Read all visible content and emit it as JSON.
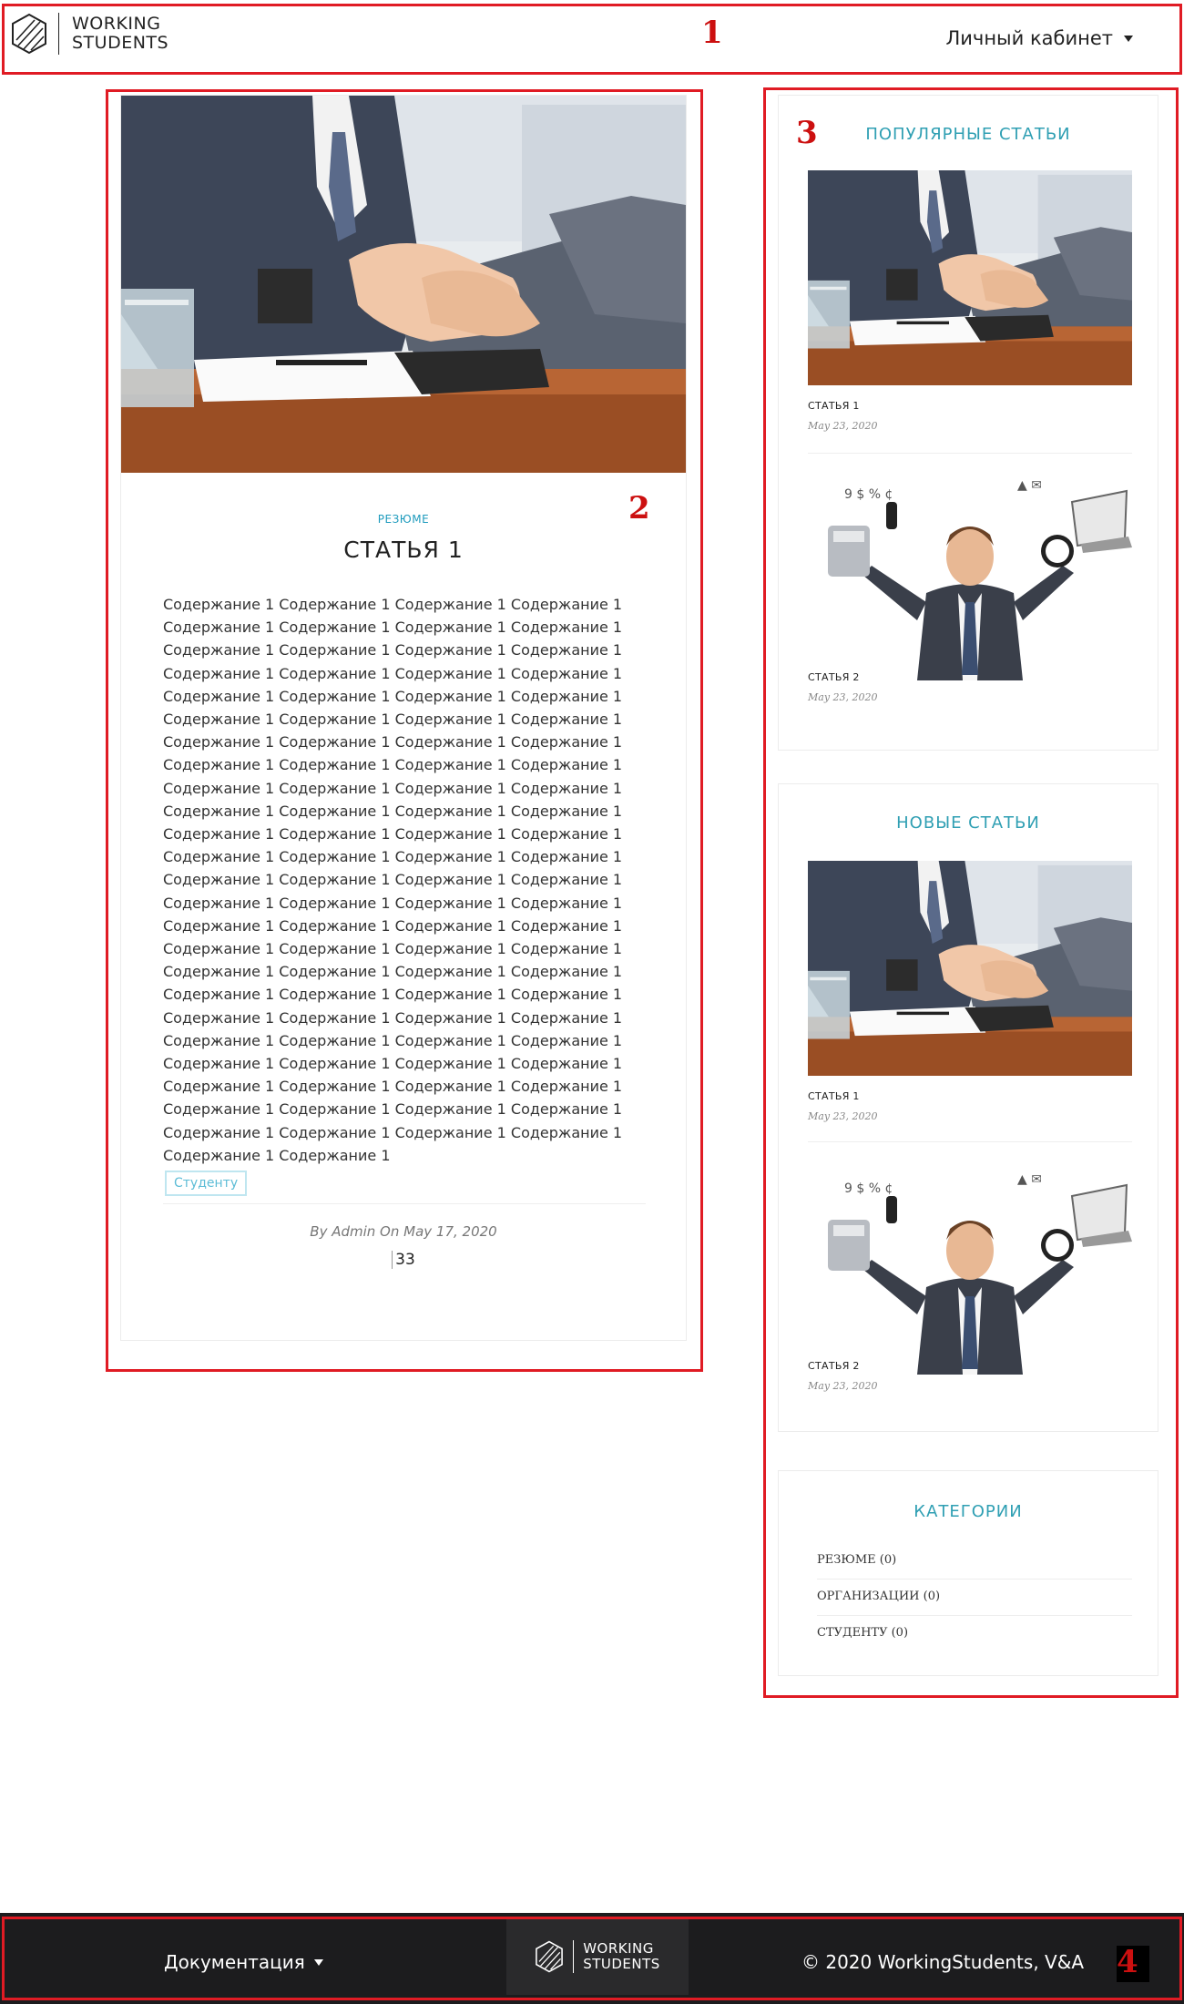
{
  "header": {
    "logo_line1": "WORKING",
    "logo_line2": "STUDENTS",
    "account_label": "Личный кабинет"
  },
  "annotations": [
    "1",
    "2",
    "3",
    "4"
  ],
  "article": {
    "category": "РЕЗЮМЕ",
    "title": "СТАТЬЯ 1",
    "body": "Содержание 1 Содержание 1 Содержание 1 Содержание 1 Содержание 1 Содержание 1 Содержание 1 Содержание 1 Содержание 1 Содержание 1 Содержание 1 Содержание 1 Содержание 1 Содержание 1 Содержание 1 Содержание 1 Содержание 1 Содержание 1 Содержание 1 Содержание 1 Содержание 1 Содержание 1 Содержание 1 Содержание 1 Содержание 1 Содержание 1 Содержание 1 Содержание 1 Содержание 1 Содержание 1 Содержание 1 Содержание 1 Содержание 1 Содержание 1 Содержание 1 Содержание 1 Содержание 1 Содержание 1 Содержание 1 Содержание 1 Содержание 1 Содержание 1 Содержание 1 Содержание 1 Содержание 1 Содержание 1 Содержание 1 Содержание 1 Содержание 1 Содержание 1 Содержание 1 Содержание 1 Содержание 1 Содержание 1 Содержание 1 Содержание 1 Содержание 1 Содержание 1 Содержание 1 Содержание 1 Содержание 1 Содержание 1 Содержание 1 Содержание 1 Содержание 1 Содержание 1 Содержание 1 Содержание 1 Содержание 1 Содержание 1 Содержание 1 Содержание 1 Содержание 1 Содержание 1 Содержание 1 Содержание 1 Содержание 1 Содержание 1 Содержание 1 Содержание 1 Содержание 1 Содержание 1 Содержание 1 Содержание 1 Содержание 1 Содержание 1 Содержание 1 Содержание 1 Содержание 1 Содержание 1 Содержание 1 Содержание 1 Содержание 1 Содержание 1 Содержание 1 Содержание 1 Содержание 1 Содержание 1",
    "tag": "Студенту",
    "byline": "By Admin On May 17, 2020",
    "views": "33"
  },
  "sidebar": {
    "popular": {
      "title": "ПОПУЛЯРНЫЕ СТАТЬИ",
      "posts": [
        {
          "title": "СТАТЬЯ 1",
          "date": "May 23, 2020",
          "image": "handshake-photo"
        },
        {
          "title": "СТАТЬЯ 2",
          "date": "May 23, 2020",
          "image": "multitasking-businessman-photo"
        }
      ]
    },
    "new": {
      "title": "НОВЫЕ СТАТЬИ",
      "posts": [
        {
          "title": "СТАТЬЯ 1",
          "date": "May 23, 2020",
          "image": "handshake-photo"
        },
        {
          "title": "СТАТЬЯ 2",
          "date": "May 23, 2020",
          "image": "multitasking-businessman-photo"
        }
      ]
    },
    "categories": {
      "title": "КАТЕГОРИИ",
      "items": [
        "РЕЗЮМЕ (0)",
        "ОРГАНИЗАЦИИ (0)",
        "СТУДЕНТУ (0)"
      ]
    }
  },
  "footer": {
    "docs_label": "Документация",
    "logo_line1": "WORKING",
    "logo_line2": "STUDENTS",
    "copyright": "© 2020 WorkingStudents, V&A"
  },
  "colors": {
    "accent": "#2f9fb3",
    "annotation_red": "#e01b24",
    "footer_bg": "#1c1c1e"
  }
}
